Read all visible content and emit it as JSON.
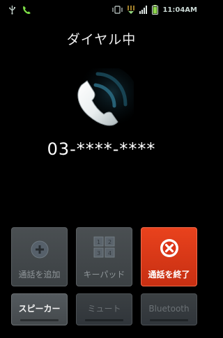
{
  "status_bar": {
    "time": "11:04AM",
    "icons": [
      "usb-icon",
      "call-active-icon",
      "vibrate-icon",
      "data-icon",
      "signal-icon",
      "battery-icon"
    ],
    "accent": "#68ce3b"
  },
  "call": {
    "status": "ダイヤル中",
    "number": "03-****-****"
  },
  "buttons": {
    "add_call": "通話を追加",
    "keypad": "キーパッド",
    "end_call": "通話を終了",
    "speaker": "スピーカー",
    "mute": "ミュート",
    "bluetooth": "Bluetooth"
  },
  "colors": {
    "end_call": "#e03a18",
    "icon_glow": "#51b0cf"
  }
}
